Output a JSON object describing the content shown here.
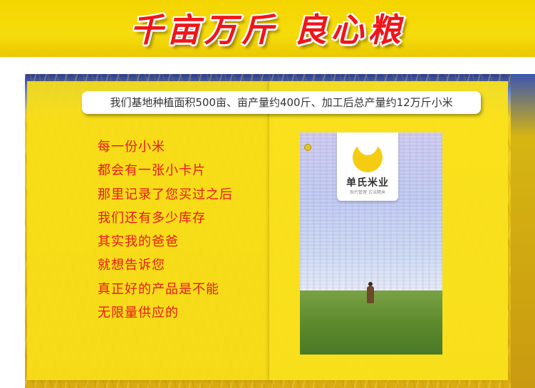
{
  "header": {
    "headline": "千亩万斤 良心粮"
  },
  "caption": "我们基地种植面积500亩、亩产量约400斤、加工后总产量约12万斤小米",
  "poem": {
    "lines": [
      "每一份小米",
      "都会有一张小卡片",
      "那里记录了您买过之后",
      "我们还有多少库存",
      "其实我的爸爸",
      "就想告诉您",
      "真正好的产品是不能",
      "无限量供应的"
    ]
  },
  "card": {
    "brand_name": "单氏米业",
    "brand_tagline": "现代管理 古法精米",
    "brand_color": "#f5cc12"
  },
  "colors": {
    "headline_red": "#f0151b",
    "band_yellow": "#f4d500",
    "poem_red": "#e8181e"
  }
}
